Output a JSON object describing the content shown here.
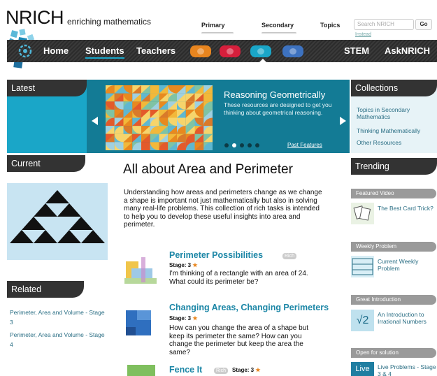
{
  "header": {
    "brand": "NRICH",
    "tagline": "enriching mathematics",
    "stage_tabs": [
      "Primary",
      "Secondary"
    ],
    "topics_label": "Topics",
    "search_placeholder": "Search NRICH",
    "go_label": "Go",
    "search_sublink": "Instead"
  },
  "nav": {
    "items": [
      "Home",
      "Students",
      "Teachers"
    ],
    "active": "Students",
    "right_items": [
      "STEM",
      "AskNRICH"
    ],
    "pills": [
      {
        "color": "#e8851f",
        "name": "orange-category-icon"
      },
      {
        "color": "#d61f3c",
        "name": "red-category-icon"
      },
      {
        "color": "#1aa6c8",
        "name": "teal-category-icon"
      },
      {
        "color": "#3d72c0",
        "name": "blue-category-icon"
      }
    ]
  },
  "sections": {
    "latest": "Latest",
    "current": "Current",
    "related": "Related",
    "collections": "Collections",
    "trending": "Trending"
  },
  "feature": {
    "title": "Reasoning Geometrically",
    "description": "These resources are designed to get you thinking about geometrical reasoning.",
    "past_features": "Past Features",
    "slide_count": 5,
    "active_slide": 2
  },
  "related_links": [
    "Perimeter, Area and Volume - Stage 3",
    "Perimeter, Area and Volume - Stage 4"
  ],
  "main": {
    "title": "All about Area and Perimeter",
    "intro": "Understanding how areas and perimeters change as we change a shape is important not just mathematically but also in solving many real-life problems. This collection of rich tasks is intended to help you to develop these useful insights into area and perimeter.",
    "tasks": [
      {
        "title": "Perimeter Possibilities",
        "tag": "Rich",
        "stage": "Stage: 3",
        "description": "I'm thinking of a rectangle with an area of 24. What could its perimeter be?"
      },
      {
        "title": "Changing Areas, Changing Perimeters",
        "stage": "Stage: 3",
        "description": "How can you change the area of a shape but keep its perimeter the same? How can you change the perimeter but keep the area the same?"
      },
      {
        "title": "Fence It",
        "tag": "Rich",
        "stage": "Stage: 3"
      }
    ],
    "star": "★"
  },
  "collections": {
    "links": [
      "Topics in Secondary Mathematics",
      "Thinking Mathematically",
      "Other Resources"
    ]
  },
  "trending": [
    {
      "label": "Featured Video",
      "text": "The Best Card Trick?"
    },
    {
      "label": "Weekly Problem",
      "text": "Current Weekly Problem"
    },
    {
      "label": "Great Introduction",
      "text": "An Introduction to Irrational Numbers"
    },
    {
      "label": "Open for solution",
      "text": "Live Problems - Stage 3 & 4"
    }
  ],
  "trend_icon_text": {
    "sqrt": "√2",
    "live": "Live"
  },
  "colors": {
    "accent_teal": "#1aa6c8",
    "dark_teal": "#137b95",
    "link": "#2a6e84",
    "task_title": "#1b86a6",
    "star": "#e9841a"
  }
}
